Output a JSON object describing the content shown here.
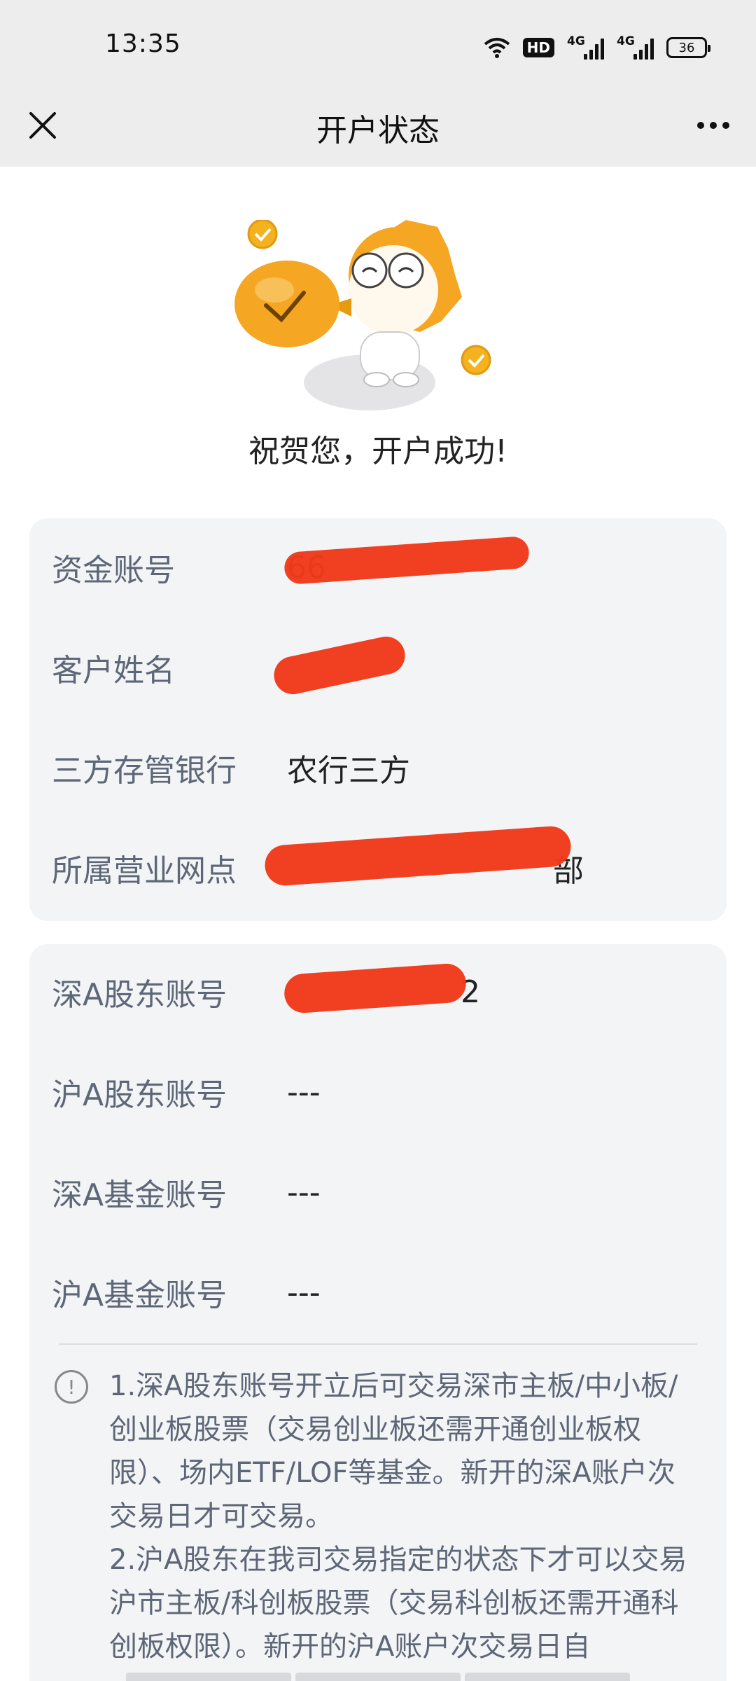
{
  "status_bar": {
    "time": "13:35",
    "hd_label": "HD",
    "net1_label": "4G",
    "net2_label": "4G",
    "battery": "36",
    "icons": [
      "wifi-icon",
      "hd-icon",
      "signal-icon",
      "signal-icon",
      "battery-icon"
    ]
  },
  "nav": {
    "title": "开户状态",
    "close_icon": "close-icon",
    "more_icon": "more-icon"
  },
  "hero": {
    "success_message": "祝贺您，开户成功!"
  },
  "account_info": {
    "rows": [
      {
        "label": "资金账号",
        "value": "66"
      },
      {
        "label": "客户姓名",
        "value": ""
      },
      {
        "label": "三方存管银行",
        "value": "农行三方"
      },
      {
        "label": "所属营业网点",
        "value": "部"
      }
    ]
  },
  "shareholder_info": {
    "rows": [
      {
        "label": "深A股东账号",
        "value": "2"
      },
      {
        "label": "沪A股东账号",
        "value": "---"
      },
      {
        "label": "深A基金账号",
        "value": "---"
      },
      {
        "label": "沪A基金账号",
        "value": "---"
      }
    ]
  },
  "notice": {
    "icon": "info-icon",
    "paragraphs": [
      "1.深A股东账号开立后可交易深市主板/中小板/创业板股票（交易创业板还需开通创业板权限）、场内ETF/LOF等基金。新开的深A账户次交易日才可交易。",
      "2.沪A股东在我司交易指定的状态下才可以交易沪市主板/科创板股票（交易科创板还需开通科创板权限）。新开的沪A账户次交易日自"
    ]
  },
  "colors": {
    "background": "#ffffff",
    "bar_background": "#ededed",
    "card_background": "#f3f4f6",
    "label": "#5e6777",
    "redaction": "#f03a1a",
    "mascot_orange": "#f5a623"
  }
}
